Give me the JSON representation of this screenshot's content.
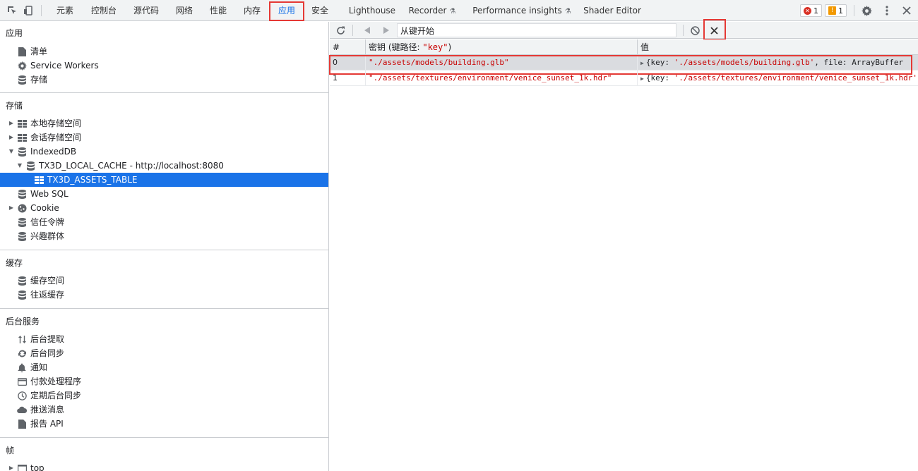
{
  "tabs": [
    {
      "label": "元素"
    },
    {
      "label": "控制台"
    },
    {
      "label": "源代码"
    },
    {
      "label": "网络"
    },
    {
      "label": "性能"
    },
    {
      "label": "内存"
    },
    {
      "label": "应用"
    },
    {
      "label": "安全"
    },
    {
      "label": "Lighthouse"
    },
    {
      "label": "Recorder"
    },
    {
      "label": "Performance insights"
    },
    {
      "label": "Shader Editor"
    }
  ],
  "active_tab": "应用",
  "status": {
    "errors": "1",
    "warnings": "1"
  },
  "sidebar": {
    "app": {
      "title": "应用",
      "items": [
        "清单",
        "Service Workers",
        "存储"
      ]
    },
    "storage": {
      "title": "存储",
      "items": [
        "本地存储空间",
        "会话存储空间",
        "IndexedDB",
        "TX3D_LOCAL_CACHE - http://localhost:8080",
        "TX3D_ASSETS_TABLE",
        "Web SQL",
        "Cookie",
        "信任令牌",
        "兴趣群体"
      ]
    },
    "cache": {
      "title": "缓存",
      "items": [
        "缓存空间",
        "往返缓存"
      ]
    },
    "background": {
      "title": "后台服务",
      "items": [
        "后台提取",
        "后台同步",
        "通知",
        "付款处理程序",
        "定期后台同步",
        "推送消息",
        "报告 API"
      ]
    },
    "frames": {
      "title": "帧",
      "items": [
        "top"
      ]
    }
  },
  "toolbar": {
    "key_input_value": "从键开始"
  },
  "table": {
    "headers": {
      "num": "#",
      "key_prefix": "密钥 (键路径: ",
      "key_path": "\"key\"",
      "key_suffix": ")",
      "value": "值"
    },
    "rows": [
      {
        "num": "0",
        "key": "\"./assets/models/building.glb\"",
        "value_prefix": "{key: ",
        "value_str": "'./assets/models/building.glb'",
        "value_suffix": ", file: ArrayBuffer"
      },
      {
        "num": "1",
        "key": "\"./assets/textures/environment/venice_sunset_1k.hdr\"",
        "value_prefix": "{key: ",
        "value_str": "'./assets/textures/environment/venice_sunset_1k.hdr'",
        "value_suffix": ""
      }
    ]
  },
  "colors": {
    "accent": "#1a73e8",
    "highlight": "#e53935",
    "string": "#c80000"
  }
}
